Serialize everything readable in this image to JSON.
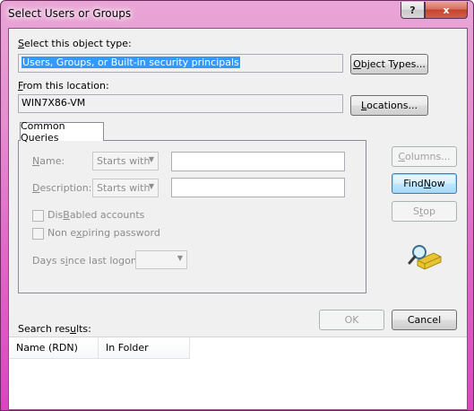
{
  "window": {
    "title": "Select Users or Groups",
    "help_label": "?",
    "close_label": "x"
  },
  "object_type": {
    "label_prefix": "S",
    "label_rest": "elect this object type:",
    "value": "Users, Groups, or Built-in security principals",
    "button_u": "O",
    "button_rest": "bject Types..."
  },
  "location": {
    "label_prefix": "F",
    "label_rest": "rom this location:",
    "value": "WIN7X86-VM",
    "button_u": "L",
    "button_rest": "ocations..."
  },
  "queries": {
    "tab_label": "Common Queries",
    "name_label_u": "N",
    "name_label_rest": "ame:",
    "name_mode": "Starts with",
    "description_label_u": "D",
    "description_label_rest": "escription:",
    "description_mode": "Starts with",
    "disabled_accounts_u": "B",
    "disabled_accounts_pre": "Dis",
    "disabled_accounts_post": "abled accounts",
    "non_expiring_pre": "Non e",
    "non_expiring_u": "x",
    "non_expiring_post": "piring password",
    "days_pre": "Days s",
    "days_u": "i",
    "days_post": "nce last logon:"
  },
  "actions": {
    "columns_u": "C",
    "columns_rest": "olumns...",
    "find_pre": "Find ",
    "find_u": "N",
    "find_post": "ow",
    "stop_pre": "S",
    "stop_u": "t",
    "stop_post": "op",
    "ok_label": "OK",
    "cancel_label": "Cancel"
  },
  "results": {
    "label_pre": "Search res",
    "label_u": "u",
    "label_post": "lts:",
    "columns": [
      "Name (RDN)",
      "In Folder"
    ]
  }
}
